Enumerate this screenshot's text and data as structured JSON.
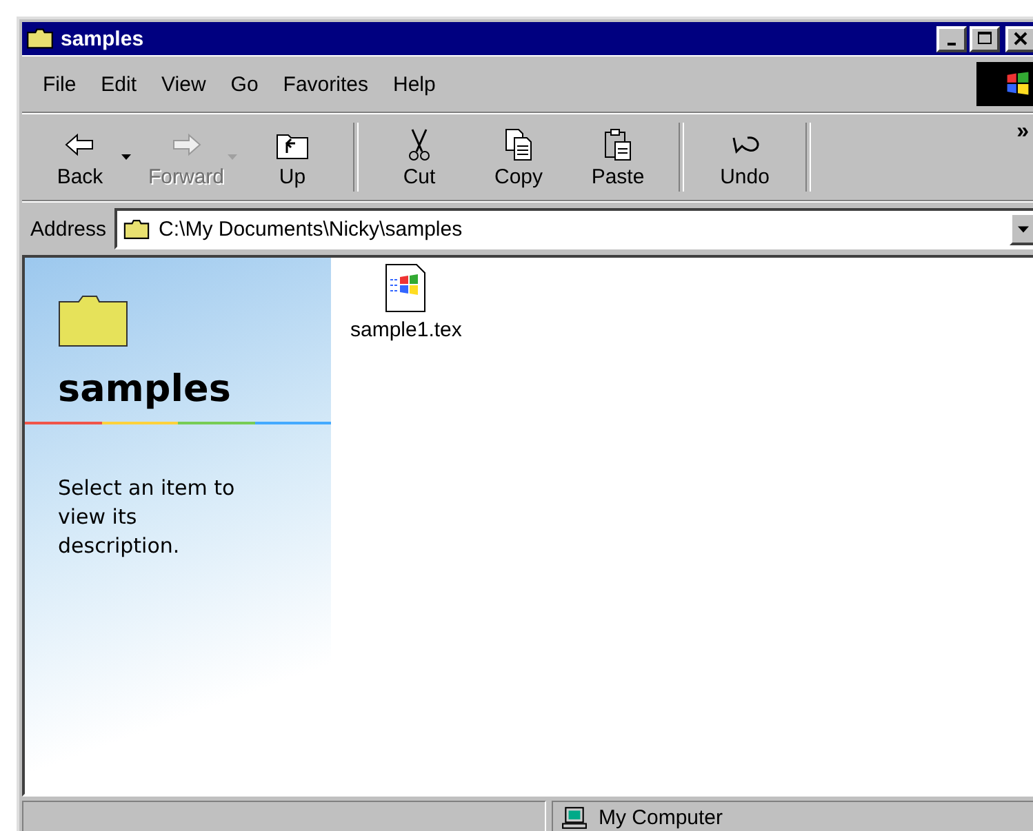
{
  "window": {
    "title": "samples"
  },
  "menu": [
    "File",
    "Edit",
    "View",
    "Go",
    "Favorites",
    "Help"
  ],
  "toolbar": {
    "groups": [
      [
        {
          "label": "Back",
          "kind": "back",
          "disabled": false,
          "dropdown": true
        },
        {
          "label": "Forward",
          "kind": "forward",
          "disabled": true,
          "dropdown": true
        },
        {
          "label": "Up",
          "kind": "up",
          "disabled": false,
          "dropdown": false
        }
      ],
      [
        {
          "label": "Cut",
          "kind": "cut",
          "disabled": false,
          "dropdown": false
        },
        {
          "label": "Copy",
          "kind": "copy",
          "disabled": false,
          "dropdown": false
        },
        {
          "label": "Paste",
          "kind": "paste",
          "disabled": false,
          "dropdown": false
        }
      ],
      [
        {
          "label": "Undo",
          "kind": "undo",
          "disabled": false,
          "dropdown": false
        }
      ]
    ],
    "overflow": "»"
  },
  "address": {
    "label": "Address",
    "value": "C:\\My Documents\\Nicky\\samples"
  },
  "info_panel": {
    "title": "samples",
    "description": "Select an item to view its description."
  },
  "files": [
    {
      "name": "sample1.tex",
      "selected": false
    }
  ],
  "status_bar": {
    "location": "My Computer"
  }
}
